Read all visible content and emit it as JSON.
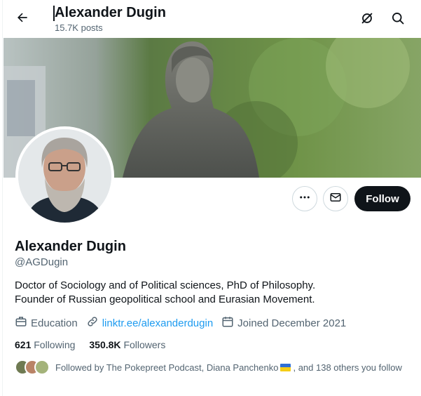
{
  "header": {
    "name": "Alexander Dugin",
    "posts": "15.7K posts",
    "icons": [
      "back-arrow-icon",
      "grok-slash-icon",
      "search-icon"
    ]
  },
  "profile": {
    "name": "Alexander Dugin",
    "handle": "@AGDugin",
    "bio_line1": "Doctor of Sociology and of Political sciences, PhD of Philosophy.",
    "bio_line2": "Founder of Russian geopolitical school and Eurasian Movement.",
    "category": "Education",
    "link": "linktr.ee/alexanderdugin",
    "joined": "Joined December 2021"
  },
  "actions": {
    "more_icon": "more-icon",
    "message_icon": "mail-icon",
    "follow_label": "Follow"
  },
  "stats": {
    "following_count": "621",
    "following_label": "Following",
    "followers_count": "350.8K",
    "followers_label": "Followers"
  },
  "followed_by": {
    "prefix": "Followed by The Pokepreet Podcast, Diana Panchenko",
    "flag": "ukraine-flag",
    "suffix": ", and 138 others you follow"
  },
  "colors": {
    "accent": "#1d9bf0",
    "text": "#0f1419",
    "muted": "#536471",
    "follow_bg": "#0f1419"
  }
}
